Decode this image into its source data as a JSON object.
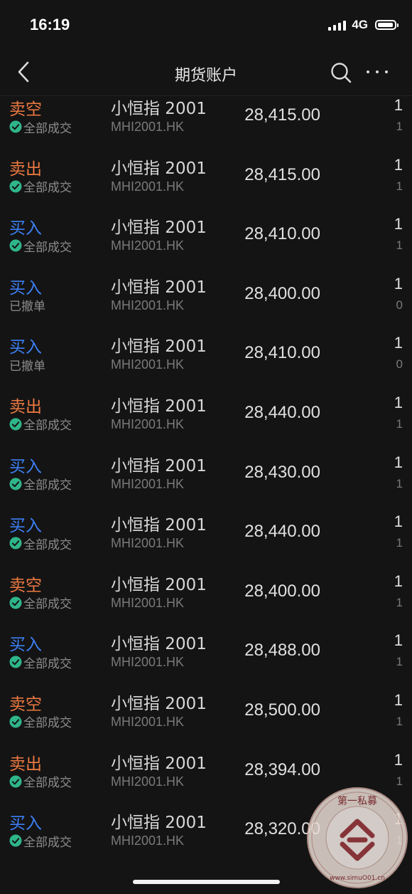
{
  "status_bar": {
    "time": "16:19",
    "network": "4G"
  },
  "nav": {
    "title": "期货账户",
    "back_icon": "chevron-left-icon",
    "search_icon": "search-icon",
    "more_icon": "more-horizontal-icon"
  },
  "colors": {
    "sell": "#ee7a42",
    "buy": "#3d80f5",
    "filled_check": "#2fb58a"
  },
  "orders": [
    {
      "side": "卖空",
      "side_type": "sell",
      "status": "全部成交",
      "status_icon": true,
      "name": "小恒指 2001",
      "code": "MHI2001.HK",
      "price": "28,415.00",
      "qty": "1",
      "filled": "1"
    },
    {
      "side": "卖出",
      "side_type": "sell",
      "status": "全部成交",
      "status_icon": true,
      "name": "小恒指 2001",
      "code": "MHI2001.HK",
      "price": "28,415.00",
      "qty": "1",
      "filled": "1"
    },
    {
      "side": "买入",
      "side_type": "buy",
      "status": "全部成交",
      "status_icon": true,
      "name": "小恒指 2001",
      "code": "MHI2001.HK",
      "price": "28,410.00",
      "qty": "1",
      "filled": "1"
    },
    {
      "side": "买入",
      "side_type": "buy",
      "status": "已撤单",
      "status_icon": false,
      "name": "小恒指 2001",
      "code": "MHI2001.HK",
      "price": "28,400.00",
      "qty": "1",
      "filled": "0"
    },
    {
      "side": "买入",
      "side_type": "buy",
      "status": "已撤单",
      "status_icon": false,
      "name": "小恒指 2001",
      "code": "MHI2001.HK",
      "price": "28,410.00",
      "qty": "1",
      "filled": "0"
    },
    {
      "side": "卖出",
      "side_type": "sell",
      "status": "全部成交",
      "status_icon": true,
      "name": "小恒指 2001",
      "code": "MHI2001.HK",
      "price": "28,440.00",
      "qty": "1",
      "filled": "1"
    },
    {
      "side": "买入",
      "side_type": "buy",
      "status": "全部成交",
      "status_icon": true,
      "name": "小恒指 2001",
      "code": "MHI2001.HK",
      "price": "28,430.00",
      "qty": "1",
      "filled": "1"
    },
    {
      "side": "买入",
      "side_type": "buy",
      "status": "全部成交",
      "status_icon": true,
      "name": "小恒指 2001",
      "code": "MHI2001.HK",
      "price": "28,440.00",
      "qty": "1",
      "filled": "1"
    },
    {
      "side": "卖空",
      "side_type": "sell",
      "status": "全部成交",
      "status_icon": true,
      "name": "小恒指 2001",
      "code": "MHI2001.HK",
      "price": "28,400.00",
      "qty": "1",
      "filled": "1"
    },
    {
      "side": "买入",
      "side_type": "buy",
      "status": "全部成交",
      "status_icon": true,
      "name": "小恒指 2001",
      "code": "MHI2001.HK",
      "price": "28,488.00",
      "qty": "1",
      "filled": "1"
    },
    {
      "side": "卖空",
      "side_type": "sell",
      "status": "全部成交",
      "status_icon": true,
      "name": "小恒指 2001",
      "code": "MHI2001.HK",
      "price": "28,500.00",
      "qty": "1",
      "filled": "1"
    },
    {
      "side": "卖出",
      "side_type": "sell",
      "status": "全部成交",
      "status_icon": true,
      "name": "小恒指 2001",
      "code": "MHI2001.HK",
      "price": "28,394.00",
      "qty": "1",
      "filled": "1"
    },
    {
      "side": "买入",
      "side_type": "buy",
      "status": "全部成交",
      "status_icon": true,
      "name": "小恒指 2001",
      "code": "MHI2001.HK",
      "price": "28,320.00",
      "qty": "1",
      "filled": "1"
    }
  ],
  "watermark": {
    "text_top": "第一私募",
    "text_bottom": "www.simuO01.cn"
  }
}
